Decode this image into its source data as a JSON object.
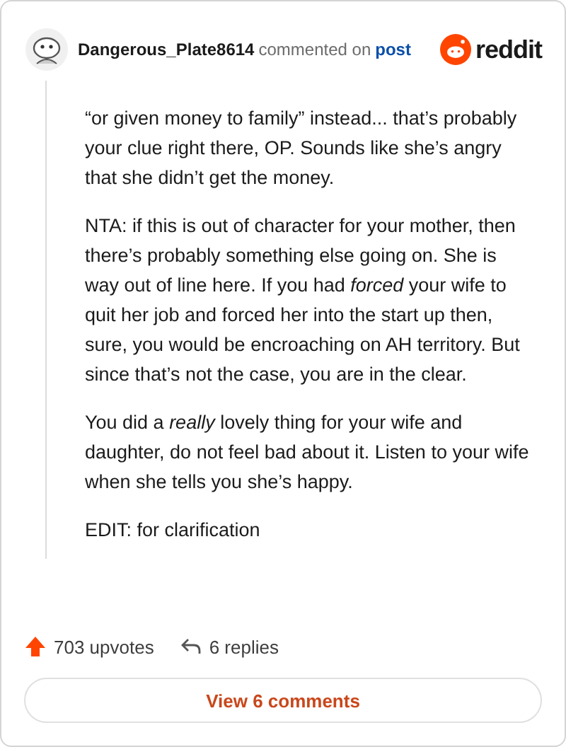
{
  "header": {
    "author": "Dangerous_Plate8614",
    "action": "commented on",
    "link": "post",
    "brand": "reddit"
  },
  "comment": {
    "paragraphs": [
      "“or given money to family” instead... that’s probably your clue right there, OP. Sounds like she’s angry that she didn’t get the money.",
      "NTA: if this is out of character for your mother, then there’s probably something else going on. She is way out of line here. If you had *forced* your wife to quit her job and forced her into the start up then, sure, you would be encroaching on AH territory. But since that’s not the case, you are in the clear.",
      "You did a *really* lovely thing for your wife and daughter, do not feel bad about it. Listen to your wife when she tells you she’s happy.",
      "EDIT: for clarification"
    ]
  },
  "stats": {
    "upvotes": "703 upvotes",
    "replies": "6 replies"
  },
  "button": "View 6 comments"
}
